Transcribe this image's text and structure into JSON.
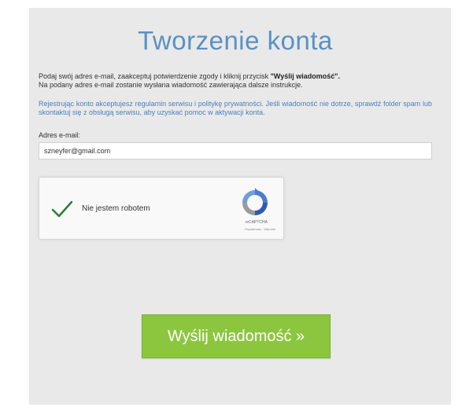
{
  "page": {
    "title": "Tworzenie konta"
  },
  "intro": {
    "line1": "Podaj swój adres e-mail, zaakceptuj potwierdzenie zgody i kliknij przycisk",
    "line1_bold": "\"Wyślij wiadomość\".",
    "line2": "Na podany adres e-mail zostanie wysłana wiadomość zawierająca dalsze instrukcje."
  },
  "notice": {
    "text": "Rejestrując konto akceptujesz regulamin serwisu i politykę prywatności. Jeśli wiadomość nie dotrze, sprawdź folder spam lub skontaktuj się z obsługą serwisu, aby uzyskać pomoc w aktywacji konta."
  },
  "form": {
    "email_label": "Adres e-mail:",
    "email_value": "szneyfer@gmail.com"
  },
  "captcha": {
    "label": "Nie jestem robotem",
    "brand": "reCAPTCHA",
    "links": "Prywatność - Warunki",
    "check_color": "#2e7d32"
  },
  "submit": {
    "label": "Wyślij wiadomość »"
  },
  "colors": {
    "title": "#5a91c4",
    "notice": "#4b7fbf",
    "button": "#8cc63f"
  }
}
